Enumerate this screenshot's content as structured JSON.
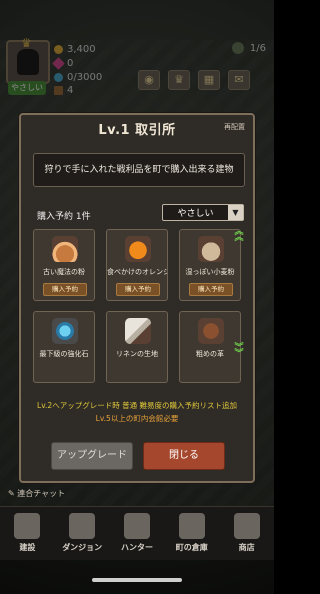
{
  "topbar": {
    "avatar_label": "やさしい",
    "gold": "3,400",
    "gems": "0",
    "orbs": "0/3000",
    "chests": "4",
    "right_stat": "1/6"
  },
  "modal": {
    "title": "Lv.1 取引所",
    "relocate_label": "再配置",
    "description": "狩りで手に入れた戦利品を町で購入出来る建物",
    "reserve_label": "購入予約 1件",
    "difficulty": "やさしい",
    "items": [
      {
        "name": "古い魔法の粉",
        "button": "購入予約",
        "icon": "powder-icon"
      },
      {
        "name": "食べかけのオレンジ",
        "button": "購入予約",
        "icon": "orange-icon"
      },
      {
        "name": "湿っぽい小麦粉",
        "button": "購入予約",
        "icon": "flour-icon"
      },
      {
        "name": "最下級の強化石",
        "button": "",
        "icon": "stone-icon"
      },
      {
        "name": "リネンの生地",
        "button": "",
        "icon": "linen-icon"
      },
      {
        "name": "粗めの革",
        "button": "",
        "icon": "leather-icon"
      }
    ],
    "notice1": "Lv.2へアップグレード時 普通 難易度の購入予約リスト追加",
    "notice2": "Lv.5以上の町内会館必要",
    "upgrade_label": "アップグレード",
    "close_label": "閉じる"
  },
  "chat": {
    "label": "連合チャット"
  },
  "nav": [
    {
      "label": "建設",
      "icon": "hammer-icon"
    },
    {
      "label": "ダンジョン",
      "icon": "dungeon-icon"
    },
    {
      "label": "ハンター",
      "icon": "hunter-icon"
    },
    {
      "label": "町の倉庫",
      "icon": "warehouse-icon"
    },
    {
      "label": "商店",
      "icon": "shop-icon"
    }
  ]
}
